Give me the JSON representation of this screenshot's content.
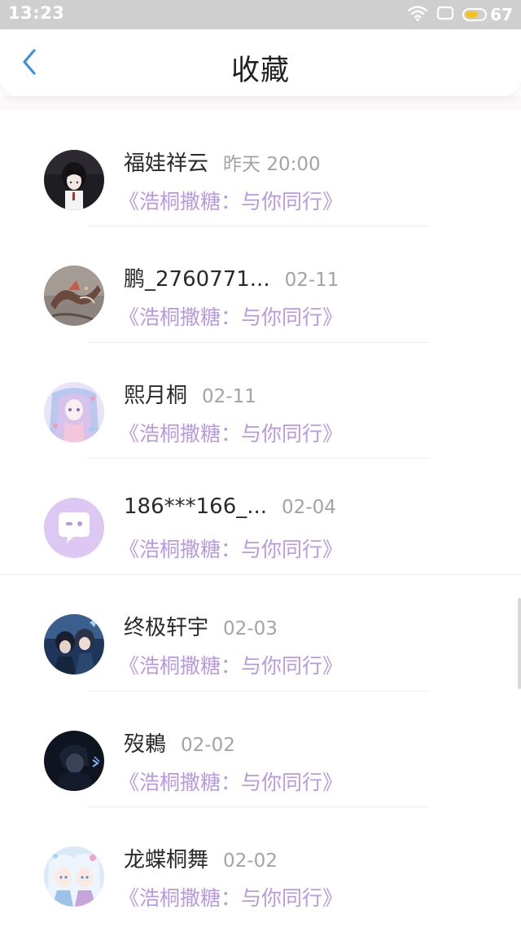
{
  "status_bar": {
    "time": "13:23",
    "battery_level": "67",
    "battery_fraction": 0.67,
    "icons": [
      "wifi-icon",
      "screen-icon",
      "battery-icon"
    ]
  },
  "header": {
    "title": "收藏",
    "back_icon": "chevron-left-icon",
    "accent_color": "#3d8fe0"
  },
  "favorites": [
    {
      "name": "福娃祥云",
      "time": "昨天 20:00",
      "book": "《浩桐撒糖：与你同行》",
      "avatar": "dark-hair-girl"
    },
    {
      "name": "鹏_2760771...",
      "time": "02-11",
      "book": "《浩桐撒糖：与你同行》",
      "avatar": "dragon"
    },
    {
      "name": "熙月桐",
      "time": "02-11",
      "book": "《浩桐撒糖：与你同行》",
      "avatar": "pastel-anime-girl"
    },
    {
      "name": "186***166_...",
      "time": "02-04",
      "book": "《浩桐撒糖：与你同行》",
      "avatar": "default-chat"
    },
    {
      "name": "终极轩宇",
      "time": "02-03",
      "book": "《浩桐撒糖：与你同行》",
      "avatar": "anime-boys-blue"
    },
    {
      "name": "歿鶇",
      "time": "02-02",
      "book": "《浩桐撒糖：与你同行》",
      "avatar": "dark-anime-boy"
    },
    {
      "name": "龙蝶桐舞",
      "time": "02-02",
      "book": "《浩桐撒糖：与你同行》",
      "avatar": "white-hair-anime"
    }
  ],
  "colors": {
    "book_title": "#b89ae0",
    "name": "#2a2a2a",
    "time": "#a3a3a3",
    "status_bar": "#cfcfcf"
  }
}
